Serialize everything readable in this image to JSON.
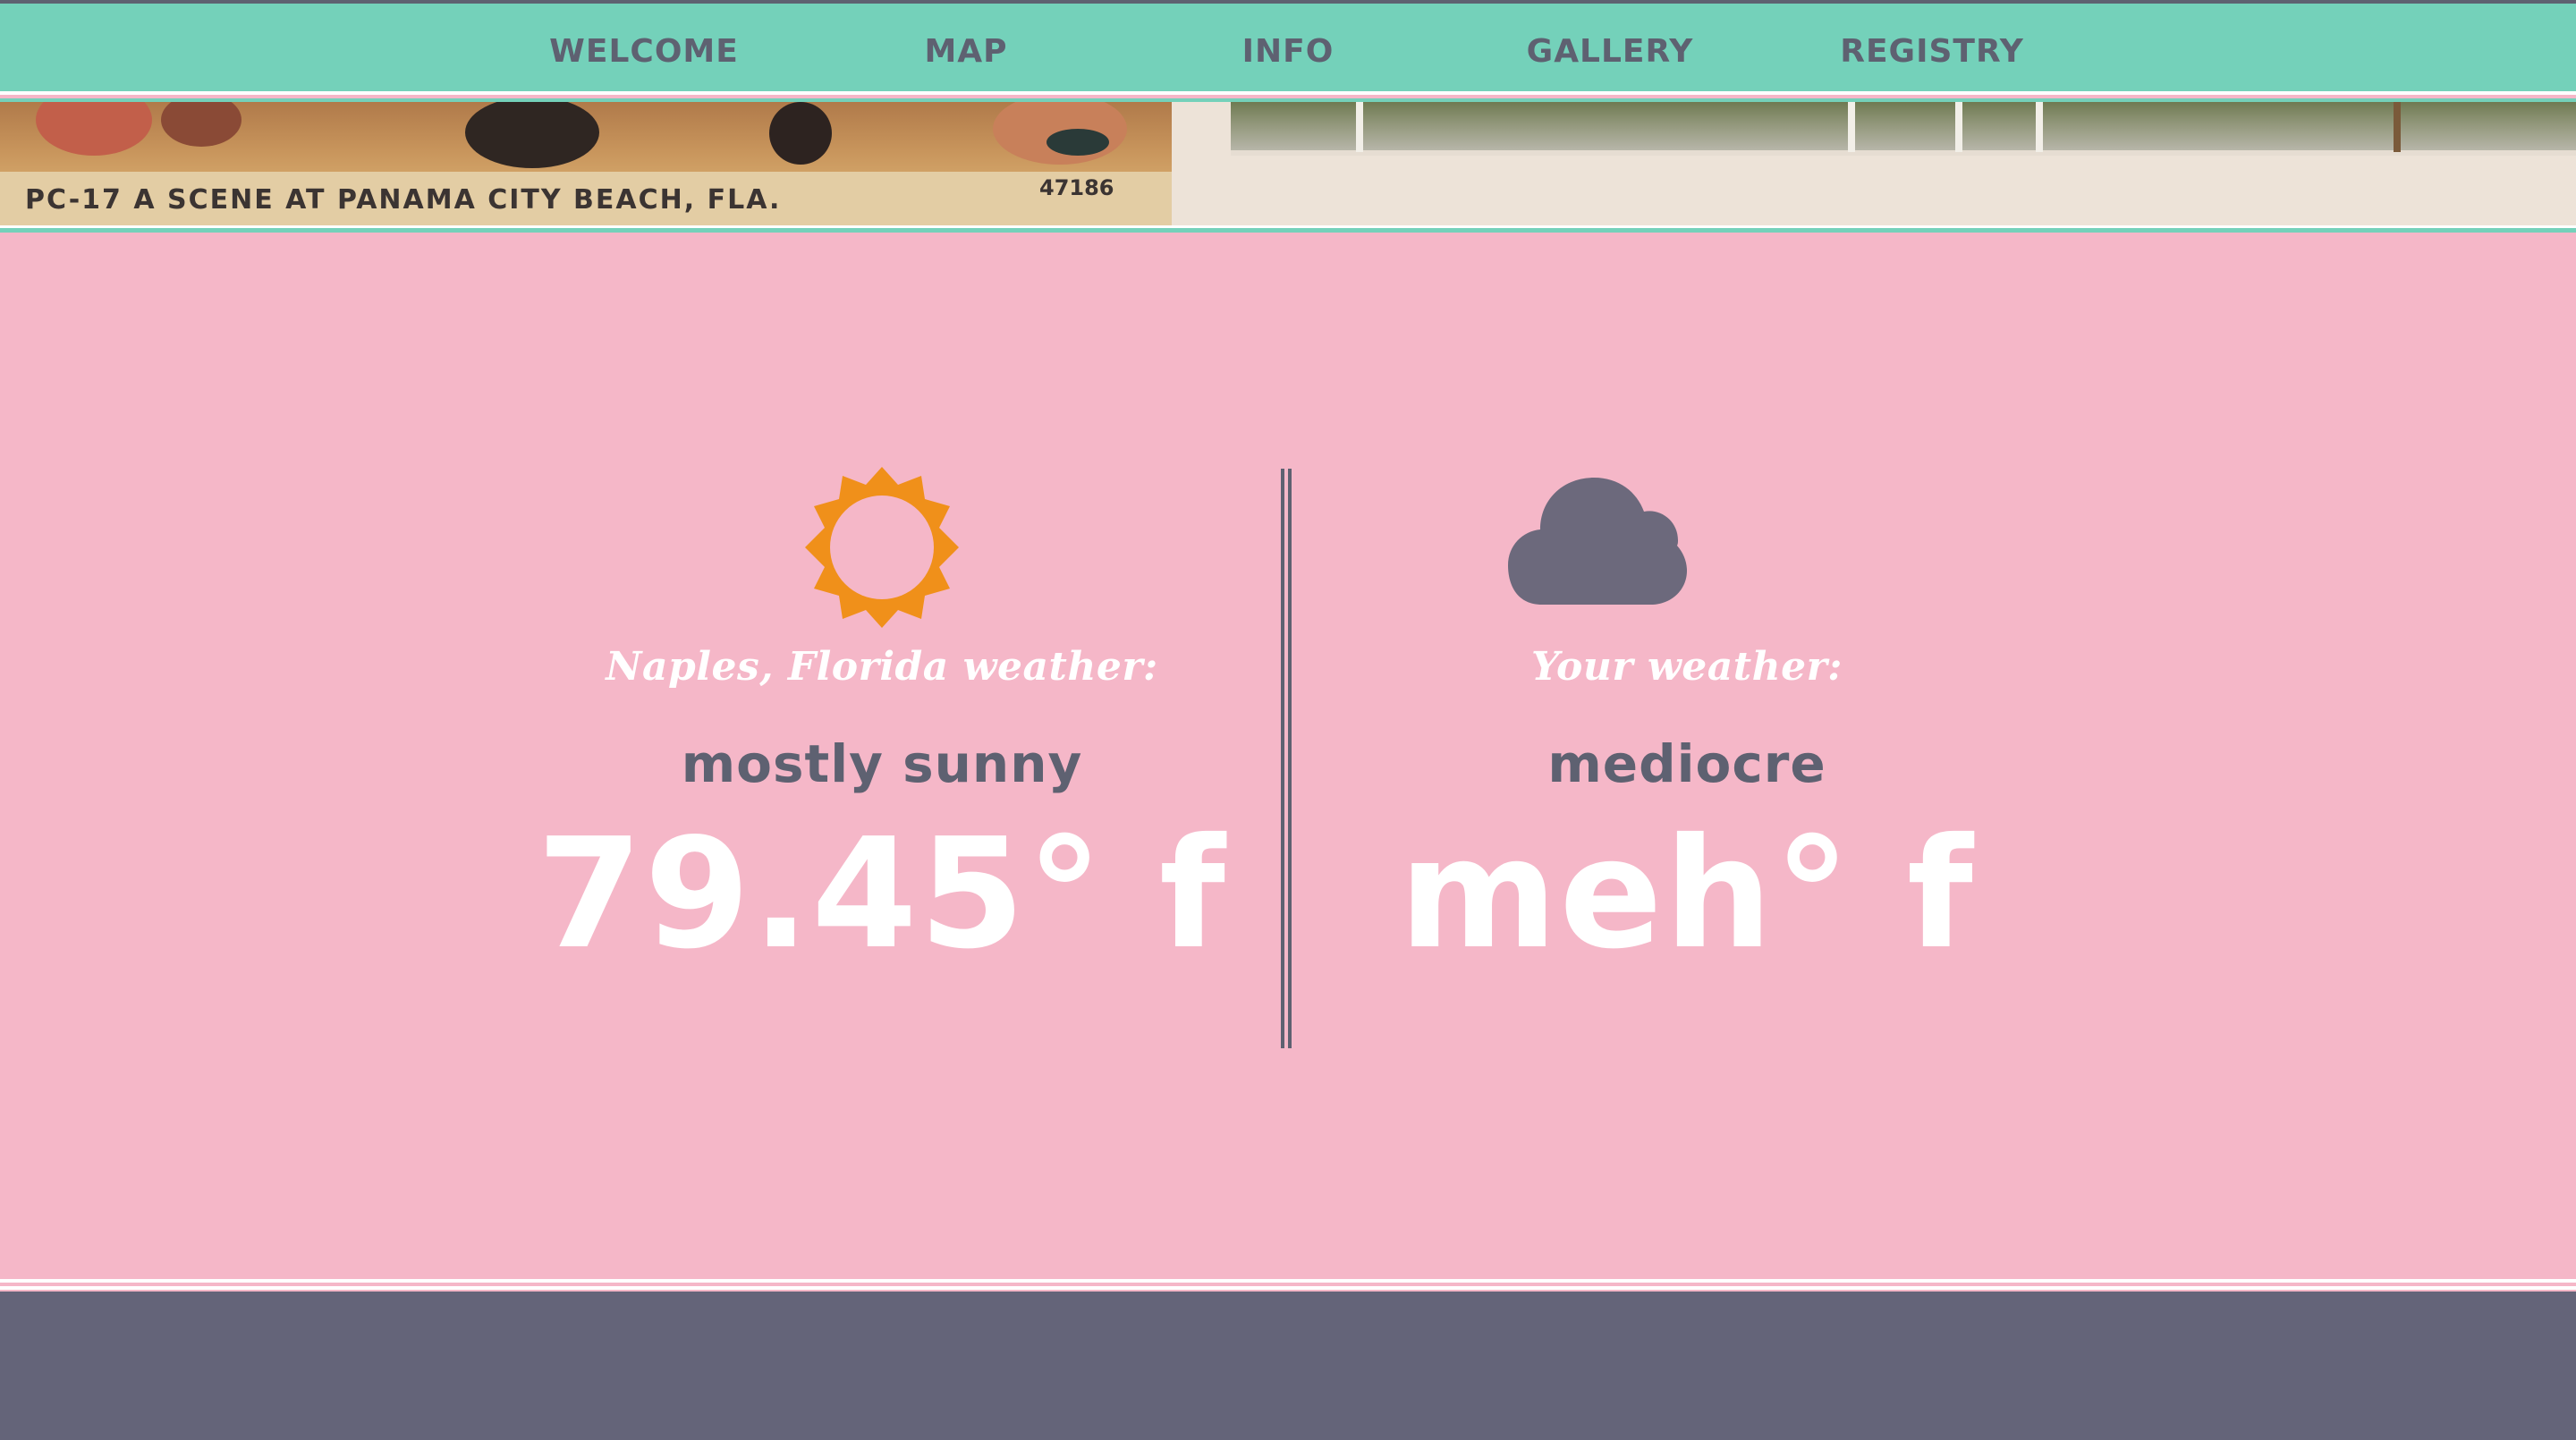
{
  "nav": {
    "items": [
      {
        "label": "WELCOME"
      },
      {
        "label": "MAP"
      },
      {
        "label": "INFO"
      },
      {
        "label": "GALLERY"
      },
      {
        "label": "REGISTRY"
      }
    ]
  },
  "banner": {
    "caption": "PC-17   A SCENE AT PANAMA CITY BEACH, FLA.",
    "number": "47186"
  },
  "weather": {
    "destination": {
      "icon": "sun-icon",
      "label": "Naples, Florida weather:",
      "condition": "mostly sunny",
      "temperature": "79.45° f"
    },
    "user": {
      "icon": "cloud-icon",
      "label": "Your weather:",
      "condition": "mediocre",
      "temperature": "meh° f"
    }
  },
  "colors": {
    "nav_bg": "#74d1ba",
    "nav_text": "#5e6171",
    "section_bg": "#f5b7c8",
    "footer_bg": "#646479",
    "sun": "#f0901a",
    "cloud": "#6c697c",
    "text_white": "#ffffff"
  }
}
